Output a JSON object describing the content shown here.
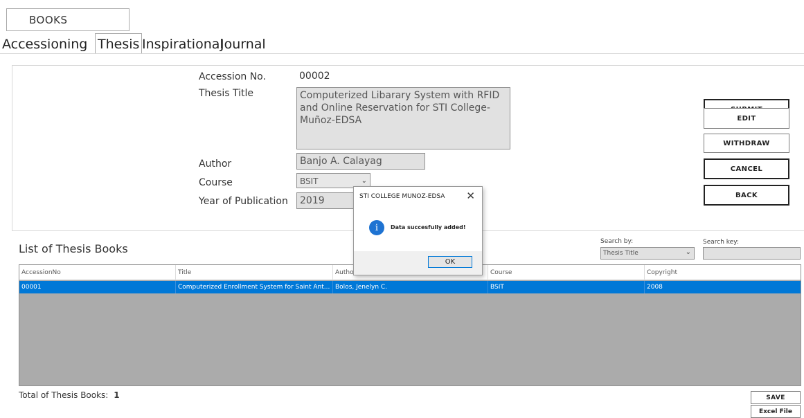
{
  "header": {
    "books_label": "BOOKS"
  },
  "tabs": [
    {
      "label": "Accessioning"
    },
    {
      "label": "Thesis"
    },
    {
      "label": "Inspirational"
    },
    {
      "label": "Journal"
    }
  ],
  "form": {
    "accession_label": "Accession No.",
    "accession_value": "00002",
    "title_label": "Thesis Title",
    "title_value": "Computerized Libarary System with RFID and Online Reservation for STI College-Muñoz-EDSA",
    "author_label": "Author",
    "author_value": "Banjo A. Calayag",
    "course_label": "Course",
    "course_value": "BSIT",
    "year_label": "Year of Publication",
    "year_value": "2019"
  },
  "buttons": {
    "submit": "SUBMIT",
    "edit": "EDIT",
    "withdraw": "WITHDRAW",
    "cancel": "CANCEL",
    "back": "BACK",
    "save": "SAVE",
    "excel": "Excel File"
  },
  "list": {
    "title": "List of Thesis Books",
    "search_by_label": "Search by:",
    "search_by_value": "Thesis Title",
    "search_key_label": "Search key:",
    "columns": [
      "AccessionNo",
      "Title",
      "Autho",
      "Course",
      "Copyright"
    ],
    "rows": [
      [
        "00001",
        "Computerized Enrollment System for Saint Ant...",
        "Bolos, Jenelyn C.",
        "BSIT",
        "2008"
      ]
    ],
    "total_label": "Total of Thesis Books:",
    "total_value": "1"
  },
  "dialog": {
    "title": "STI COLLEGE MUNOZ-EDSA",
    "message": "Data succesfully added!",
    "ok_label": "OK"
  },
  "colors": {
    "selection": "#0078d7",
    "grid_bg": "#ababab",
    "field_bg": "#e1e1e1"
  }
}
